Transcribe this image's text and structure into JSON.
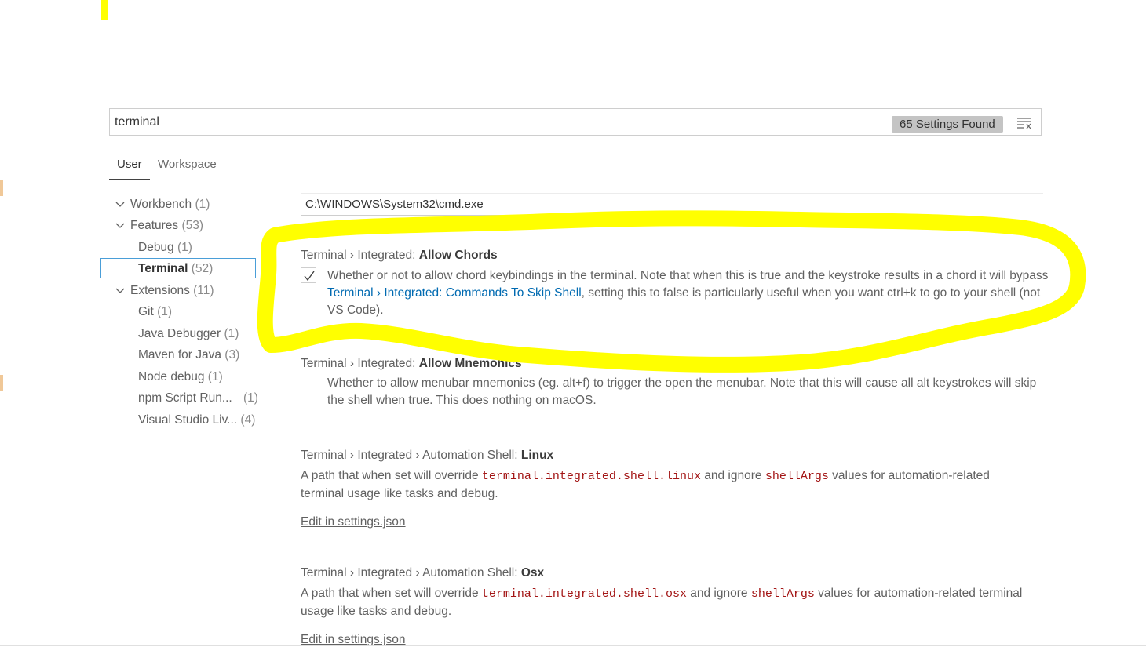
{
  "search": {
    "value": "terminal",
    "count_label": "65 Settings Found"
  },
  "tabs": [
    {
      "label": "User"
    },
    {
      "label": "Workspace"
    }
  ],
  "toc": [
    {
      "label": "Workbench",
      "count": "(1)"
    },
    {
      "label": "Features",
      "count": "(53)"
    },
    {
      "label": "Debug",
      "count": "(1)"
    },
    {
      "label": "Terminal",
      "count": "(52)"
    },
    {
      "label": "Extensions",
      "count": "(11)"
    },
    {
      "label": "Git",
      "count": "(1)"
    },
    {
      "label": "Java Debugger",
      "count": "(1)"
    },
    {
      "label": "Maven for Java",
      "count": "(3)"
    },
    {
      "label": "Node debug",
      "count": "(1)"
    },
    {
      "label": "npm Script Run...",
      "count": "(1)"
    },
    {
      "label": "Visual Studio Liv...",
      "count": "(4)"
    }
  ],
  "shell_path": "C:\\WINDOWS\\System32\\cmd.exe",
  "settings": {
    "allow_chords": {
      "category": "Terminal › Integrated: ",
      "name": "Allow Chords",
      "checked": true,
      "desc_1": "Whether or not to allow chord keybindings in the terminal. Note that when this is true and the keystroke results in a chord it will bypass ",
      "desc_link": "Terminal › Integrated: Commands To Skip Shell",
      "desc_2": ", setting this to false is particularly useful when you want ctrl+k to go to your shell (not VS Code)."
    },
    "allow_mnemonics": {
      "category": "Terminal › Integrated: ",
      "name": "Allow Mnemonics",
      "checked": false,
      "desc": "Whether to allow menubar mnemonics (eg. alt+f) to trigger the open the menubar. Note that this will cause all alt keystrokes will skip the shell when true. This does nothing on macOS."
    },
    "automation_linux": {
      "category": "Terminal › Integrated › Automation Shell: ",
      "name": "Linux",
      "desc_1": "A path that when set will override ",
      "code_1": "terminal.integrated.shell.linux",
      "desc_2": " and ignore ",
      "code_2": "shellArgs",
      "desc_3": " values for automation-related terminal usage like tasks and debug.",
      "edit_label": "Edit in settings.json"
    },
    "automation_osx": {
      "category": "Terminal › Integrated › Automation Shell: ",
      "name": "Osx",
      "desc_1": "A path that when set will override ",
      "code_1": "terminal.integrated.shell.osx",
      "desc_2": " and ignore ",
      "code_2": "shellArgs",
      "desc_3": " values for automation-related terminal usage like tasks and debug.",
      "edit_label": "Edit in settings.json"
    }
  },
  "colors": {
    "highlight": "#ffff00",
    "link": "#006ab1",
    "code": "#a31515",
    "selection_border": "#4a9ed8"
  }
}
